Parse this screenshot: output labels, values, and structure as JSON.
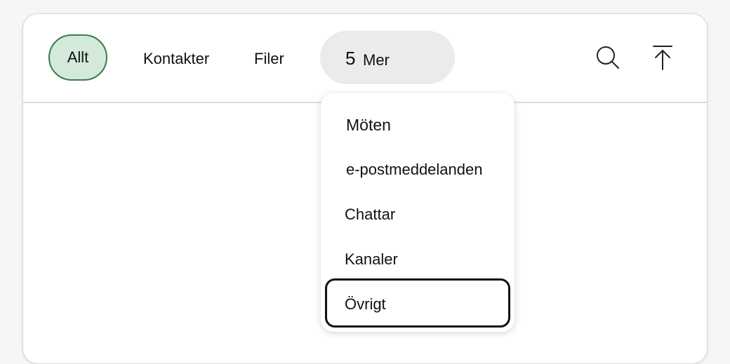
{
  "tabs": {
    "all": "Allt",
    "contacts": "Kontakter",
    "files": "Filer"
  },
  "more": {
    "count": "5",
    "label": "Mer"
  },
  "icons": {
    "search": "search-icon",
    "scroll_top": "arrow-up-to-top-icon"
  },
  "dropdown": {
    "items": [
      {
        "label": "Möten"
      },
      {
        "label": "e-postmeddelanden"
      },
      {
        "label": "Chattar"
      },
      {
        "label": "Kanaler"
      },
      {
        "label": "Övrigt"
      }
    ],
    "focused_index": 4
  },
  "colors": {
    "selected_pill_bg": "#d3eadb",
    "selected_pill_border": "#3d7a49",
    "more_pill_bg": "#ebebeb"
  }
}
